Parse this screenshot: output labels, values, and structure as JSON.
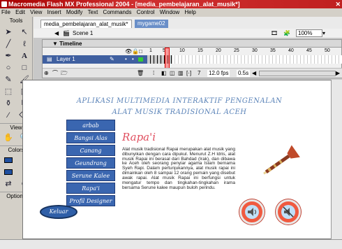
{
  "window": {
    "title": "Macromedia Flash MX Professional 2004 - [media_pembelajaran_alat_musik*]"
  },
  "menu": [
    "File",
    "Edit",
    "View",
    "Insert",
    "Modify",
    "Text",
    "Commands",
    "Control",
    "Window",
    "Help"
  ],
  "tools": {
    "header": "Tools",
    "view_label": "View",
    "colors_label": "Colors",
    "options_label": "Options"
  },
  "tabs": [
    {
      "label": "media_pembelajaran_alat_musik*",
      "active": true
    },
    {
      "label": "mygame02",
      "active": false
    }
  ],
  "scene": {
    "label": "Scene 1",
    "zoom": "100%"
  },
  "timeline": {
    "header": "Timeline",
    "ruler": [
      "1",
      "5",
      "10",
      "15",
      "20",
      "25",
      "30",
      "35",
      "40",
      "45",
      "50"
    ],
    "layer_name": "Layer 1",
    "current_frame": "7",
    "fps": "12.0 fps",
    "time": "0.5s"
  },
  "stage": {
    "title_line1": "APLIKASI MULTIMEDIA INTERAKTIF PENGENALAN",
    "title_line2": "ALAT MUSIK TRADISIONAL ACEH",
    "nav": [
      "arbab",
      "Bangsi Alas",
      "Canang",
      "Geundrang",
      "Serune Kalee",
      "Rapa'i",
      "Profil Designer"
    ],
    "content_title": "Rapa'i",
    "content_text": "Alat musik tradisional Rapai merupakan alat musik yang dibunyikan dengan cara dipukul. Menurut Z.H Idris, alat musik Rapai ini berasal dari Bahdad (Irak), dan dibawa ke Aceh oleh seorang penyiar agama Islam bernama Syeh Rapi. Dalam pertunjukannya, alat musik rapai ini dimainkan oleh 8 sampai 12 orang pemain yang disebut awak rapai. Alat musik Rapai ini berfungsi untuk mengatur tempo dan tingkahan-tingkahan irama bersama Serune kalee maupun buloh perindu.",
    "exit_label": "Keluar"
  },
  "colors": {
    "stage_title": "#5a83b8",
    "nav_button": "#3a66b0",
    "content_title": "#e05060",
    "speaker": "#f05a40",
    "title_bar": "#a60000"
  },
  "icons": [
    "arrow-icon",
    "subselect-icon",
    "line-icon",
    "lasso-icon",
    "pen-icon",
    "text-icon",
    "oval-icon",
    "rect-icon",
    "pencil-icon",
    "brush-icon",
    "freetransform-icon",
    "fill-transform-icon",
    "inkbottle-icon",
    "paintbucket-icon",
    "eyedropper-icon",
    "eraser-icon",
    "hand-icon",
    "zoom-icon",
    "speaker-on-icon",
    "speaker-off-icon",
    "trumpet-illustration"
  ]
}
